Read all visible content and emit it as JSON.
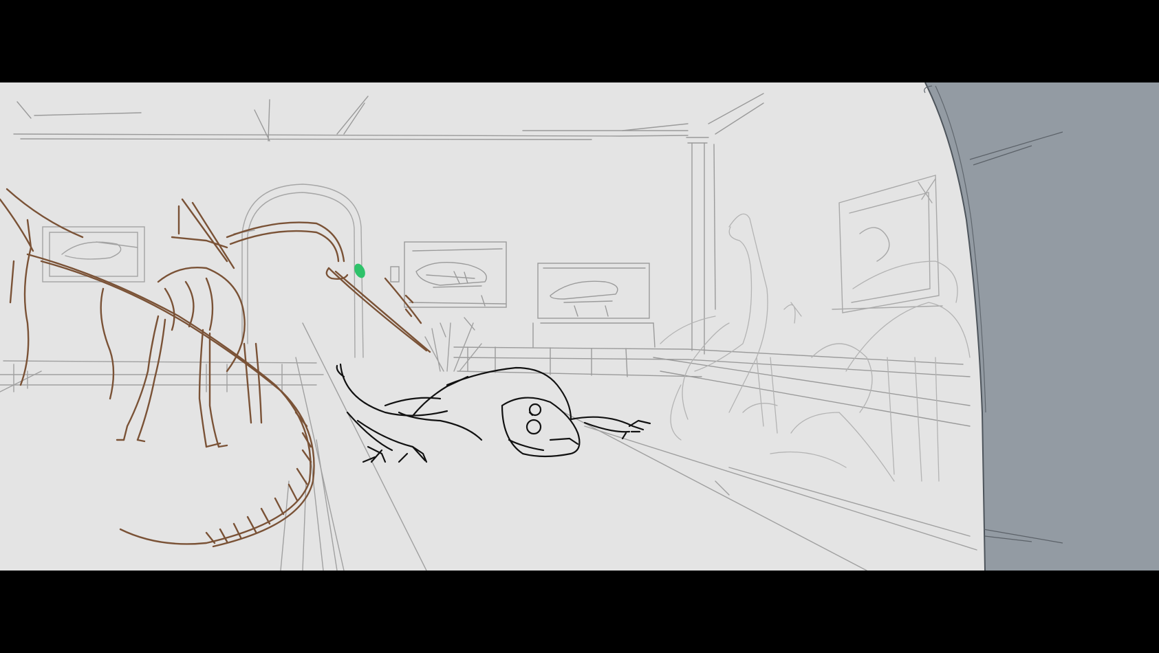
{
  "storyboard": {
    "colors": {
      "letterbox": "#000000",
      "paper": "#e4e4e4",
      "background_line": "#9a9a9a",
      "light_line": "#b3b3b3",
      "creature_brown": "#7a5236",
      "character_black": "#111111",
      "eye_green": "#2ec26a",
      "wall_gray": "#939ba3"
    },
    "layers": [
      "museum-hall-background",
      "skeleton-creature",
      "crawling-character",
      "foreground-wall"
    ]
  }
}
